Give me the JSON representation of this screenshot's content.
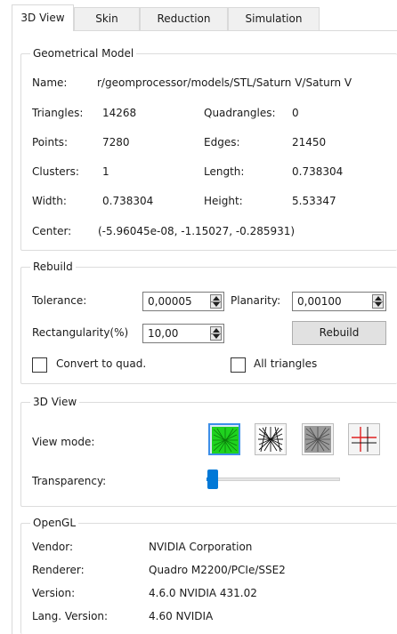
{
  "tabs": [
    "3D View",
    "Skin",
    "Reduction",
    "Simulation"
  ],
  "geo": {
    "title": "Geometrical Model",
    "name_label": "Name:",
    "name_value": "r/geomprocessor/models/STL/Saturn V/Saturn V",
    "triangles_label": "Triangles:",
    "triangles_value": "14268",
    "quadrangles_label": "Quadrangles:",
    "quadrangles_value": "0",
    "points_label": "Points:",
    "points_value": "7280",
    "edges_label": "Edges:",
    "edges_value": "21450",
    "clusters_label": "Clusters:",
    "clusters_value": "1",
    "length_label": "Length:",
    "length_value": "0.738304",
    "width_label": "Width:",
    "width_value": "0.738304",
    "height_label": "Height:",
    "height_value": "5.53347",
    "center_label": "Center:",
    "center_value": "(-5.96045e-08, -1.15027, -0.285931)"
  },
  "rebuild": {
    "title": "Rebuild",
    "tolerance_label": "Tolerance:",
    "tolerance_value": "0,00005",
    "planarity_label": "Planarity:",
    "planarity_value": "0,00100",
    "rect_label": "Rectangularity(%)",
    "rect_value": "10,00",
    "button": "Rebuild",
    "convert_label": "Convert to quad.",
    "alltri_label": "All triangles"
  },
  "view3d": {
    "title": "3D View",
    "viewmode_label": "View mode:",
    "transparency_label": "Transparency:",
    "view_modes": [
      "shaded-green-mesh-icon",
      "wireframe-mesh-icon",
      "shaded-gray-mesh-icon",
      "axes-grid-icon"
    ],
    "transparency_level": 0.0,
    "accent": "#0078d7"
  },
  "opengl": {
    "title": "OpenGL",
    "vendor_label": "Vendor:",
    "vendor_value": "NVIDIA Corporation",
    "renderer_label": "Renderer:",
    "renderer_value": "Quadro M2200/PCIe/SSE2",
    "version_label": "Version:",
    "version_value": "4.6.0 NVIDIA 431.02",
    "lang_label": "Lang. Version:",
    "lang_value": "4.60 NVIDIA"
  }
}
